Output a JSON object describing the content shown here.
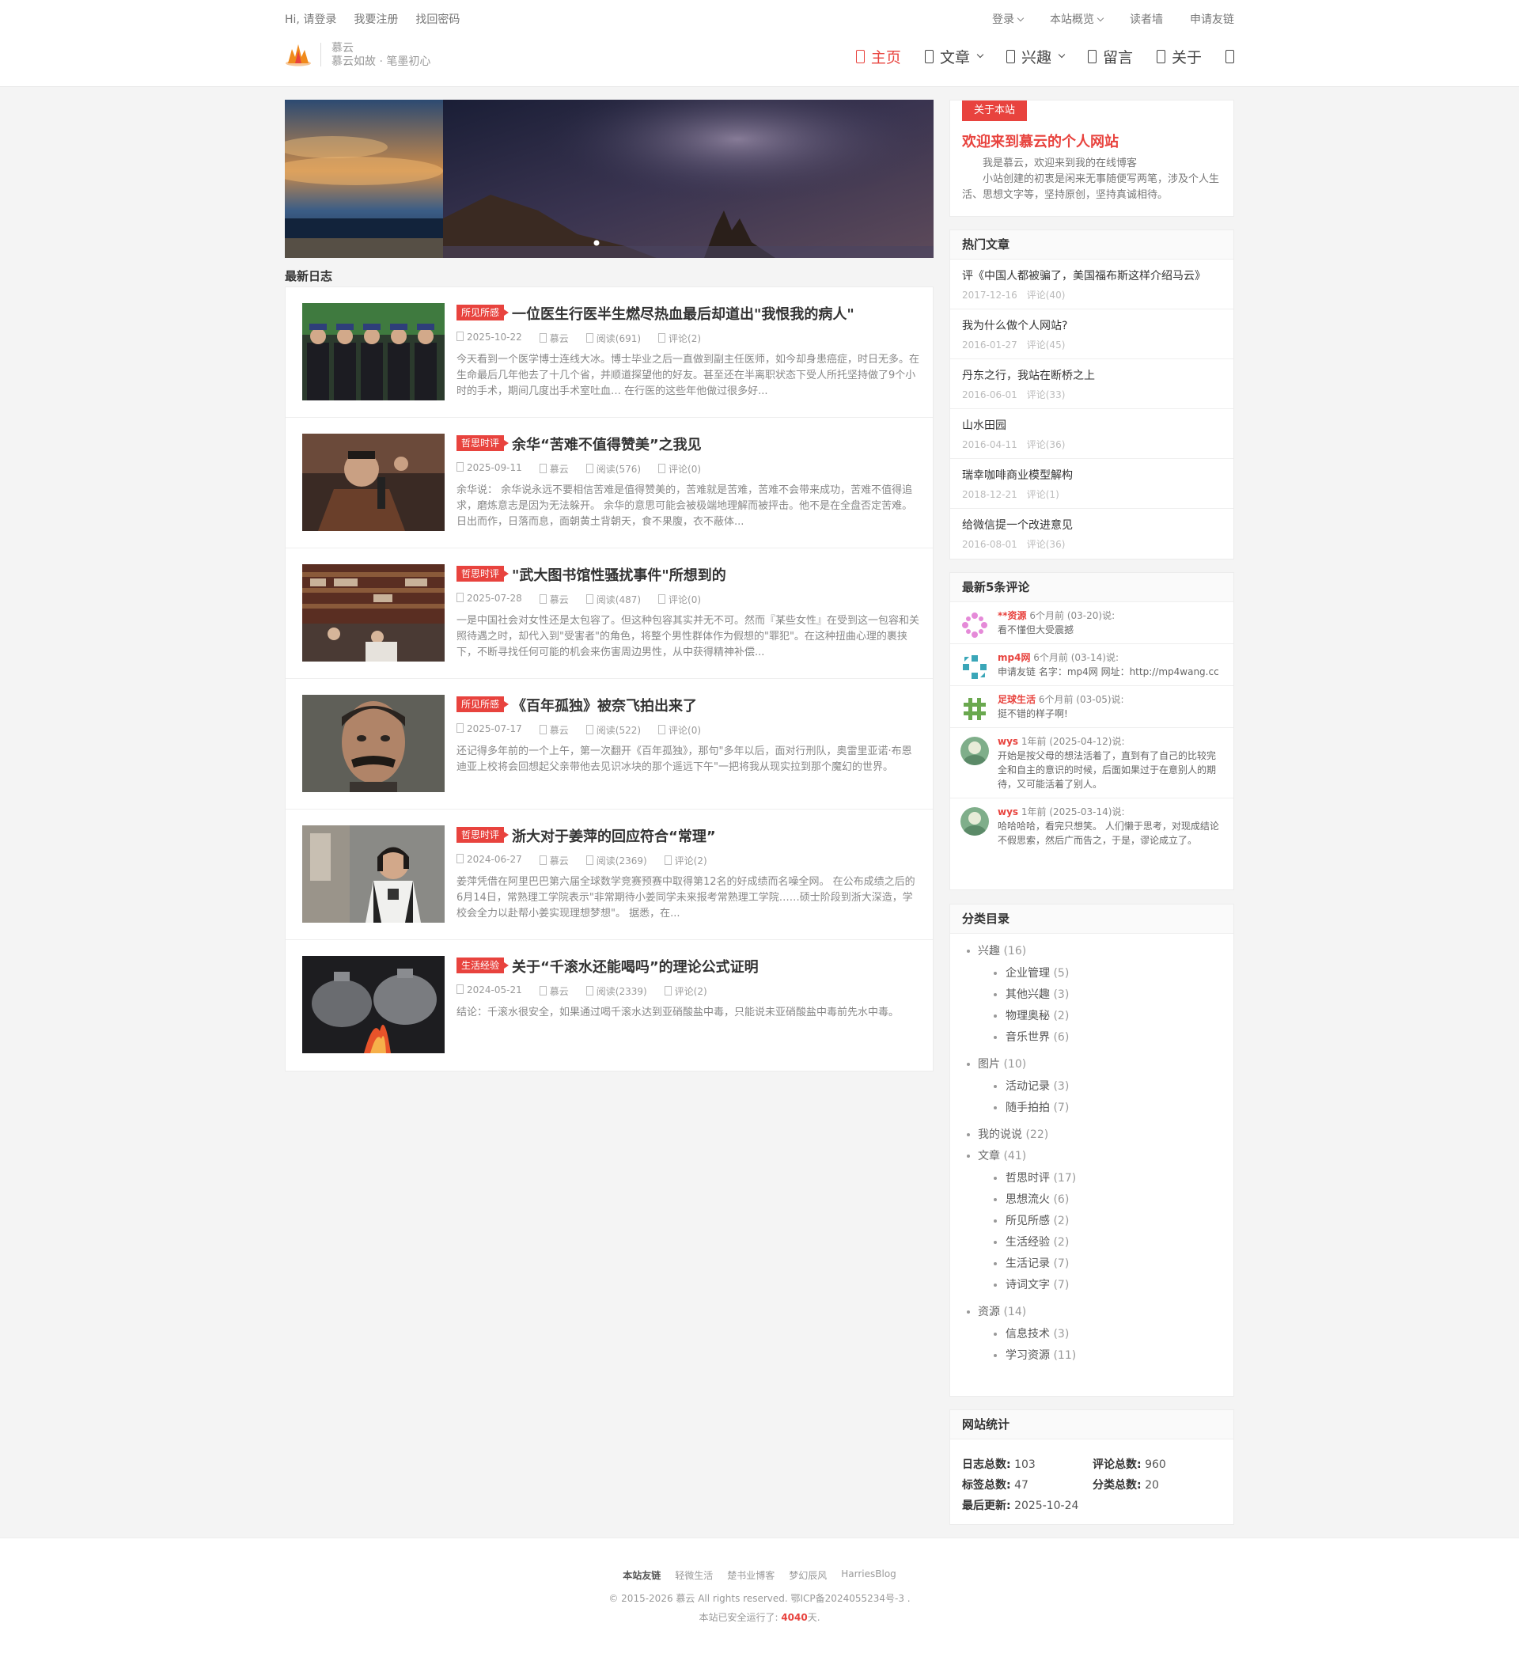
{
  "topbar": {
    "login_link": "Hi, 请登录",
    "register_link": "我要注册",
    "forgot_link": "找回密码",
    "right": [
      "登录",
      "本站概览",
      "读者墙",
      "申请友链"
    ]
  },
  "logo": {
    "name": "慕云",
    "slogan": "慕云如故 · 笔墨初心"
  },
  "nav": [
    {
      "label": "主页",
      "icon": "home-icon"
    },
    {
      "label": "文章",
      "icon": "book-icon"
    },
    {
      "label": "兴趣",
      "icon": "heart-icon"
    },
    {
      "label": "留言",
      "icon": "message-icon"
    },
    {
      "label": "关于",
      "icon": "user-icon"
    }
  ],
  "section_title": "最新日志",
  "posts": [
    {
      "tag": "所见所感",
      "title": "一位医生行医半生燃尽热血最后却道出\"我恨我的病人\"",
      "date": "2025-10-22",
      "author": "慕云",
      "views": "阅读(691)",
      "comments": "评论(2)",
      "excerpt": "今天看到一个医学博士连线大冰。博士毕业之后一直做到副主任医师，如今却身患癌症，时日无多。在生命最后几年他去了十几个省，并顺道探望他的好友。甚至还在半离职状态下受人所托坚持做了9个小时的手术，期间几度出手术室吐血… 在行医的这些年他做过很多好..."
    },
    {
      "tag": "哲思时评",
      "title": "余华“苦难不值得赞美”之我见",
      "date": "2025-09-11",
      "author": "慕云",
      "views": "阅读(576)",
      "comments": "评论(0)",
      "excerpt": "余华说： 余华说永远不要相信苦难是值得赞美的，苦难就是苦难，苦难不会带来成功，苦难不值得追求，磨炼意志是因为无法躲开。 余华的意思可能会被极端地理解而被抨击。他不是在全盘否定苦难。 日出而作，日落而息，面朝黄土背朝天，食不果腹，衣不蔽体..."
    },
    {
      "tag": "哲思时评",
      "title": "\"武大图书馆性骚扰事件\"所想到的",
      "date": "2025-07-28",
      "author": "慕云",
      "views": "阅读(487)",
      "comments": "评论(0)",
      "excerpt": "一是中国社会对女性还是太包容了。但这种包容其实并无不可。然而『某些女性』在受到这一包容和关照待遇之时，却代入到\"受害者\"的角色，将整个男性群体作为假想的\"罪犯\"。在这种扭曲心理的裹挟下，不断寻找任何可能的机会来伤害周边男性，从中获得精神补偿..."
    },
    {
      "tag": "所见所感",
      "title": "《百年孤独》被奈飞拍出来了",
      "date": "2025-07-17",
      "author": "慕云",
      "views": "阅读(522)",
      "comments": "评论(0)",
      "excerpt": "还记得多年前的一个上午，第一次翻开《百年孤独》，那句\"多年以后，面对行刑队，奥雷里亚诺·布恩迪亚上校将会回想起父亲带他去见识冰块的那个遥远下午\"一把将我从现实拉到那个魔幻的世界。"
    },
    {
      "tag": "哲思时评",
      "title": "浙大对于姜萍的回应符合“常理”",
      "date": "2024-06-27",
      "author": "慕云",
      "views": "阅读(2369)",
      "comments": "评论(2)",
      "excerpt": "姜萍凭借在阿里巴巴第六届全球数学竞赛预赛中取得第12名的好成绩而名噪全网。 在公布成绩之后的6月14日，常熟理工学院表示\"非常期待小姜同学未来报考常熟理工学院……硕士阶段到浙大深造，学校会全力以赴帮小姜实现理想梦想\"。 据悉，在..."
    },
    {
      "tag": "生活经验",
      "title": "关于“千滚水还能喝吗”的理论公式证明",
      "date": "2024-05-21",
      "author": "慕云",
      "views": "阅读(2339)",
      "comments": "评论(2)",
      "excerpt": "结论：千滚水很安全，如果通过喝千滚水达到亚硝酸盐中毒，只能说未亚硝酸盐中毒前先水中毒。"
    }
  ],
  "about": {
    "badge": "关于本站",
    "heading": "欢迎来到慕云的个人网站",
    "body": "我是慕云，欢迎来到我的在线博客",
    "body2": "小站创建的初衷是闲来无事随便写两笔，涉及个人生活、思想文字等，坚持原创，坚持真诚相待。"
  },
  "hot": {
    "title": "热门文章",
    "items": [
      {
        "title": "评《中国人都被骗了，美国福布斯这样介绍马云》",
        "date": "2017-12-16",
        "comments": "评论(40)"
      },
      {
        "title": "我为什么做个人网站?",
        "date": "2016-01-27",
        "comments": "评论(45)"
      },
      {
        "title": "丹东之行，我站在断桥之上",
        "date": "2016-06-01",
        "comments": "评论(33)"
      },
      {
        "title": "山水田园",
        "date": "2016-04-11",
        "comments": "评论(36)"
      },
      {
        "title": "瑞幸咖啡商业模型解构",
        "date": "2018-12-21",
        "comments": "评论(1)"
      },
      {
        "title": "给微信提一个改进意见",
        "date": "2016-08-01",
        "comments": "评论(36)"
      }
    ]
  },
  "comments": {
    "title": "最新5条评论",
    "items": [
      {
        "name": "**资源",
        "time": "6个月前 (03-20)说:",
        "text": "看不懂但大受震撼"
      },
      {
        "name": "mp4网",
        "time": "6个月前 (03-14)说:",
        "text": "申请友链 名字：mp4网 网址：http://mp4wang.cc"
      },
      {
        "name": "足球生活",
        "time": "6个月前 (03-05)说:",
        "text": "挺不错的样子啊!"
      },
      {
        "name": "wys",
        "time": "1年前 (2025-04-12)说:",
        "text": "开始是按父母的想法活着了，直到有了自己的比较完全和自主的意识的时候，后面如果过于在意别人的期待，又可能活着了别人。"
      },
      {
        "name": "wys",
        "time": "1年前 (2025-03-14)说:",
        "text": "哈哈哈哈，看完只想笑。 人们懒于思考，对现成结论不假思索，然后广而告之，于是，谬论成立了。"
      }
    ]
  },
  "categories": {
    "title": "分类目录",
    "groups": [
      {
        "name": "兴趣",
        "count": "(16)",
        "children": [
          {
            "name": "企业管理",
            "count": "(5)"
          },
          {
            "name": "其他兴趣",
            "count": "(3)"
          },
          {
            "name": "物理奥秘",
            "count": "(2)"
          },
          {
            "name": "音乐世界",
            "count": "(6)"
          }
        ]
      },
      {
        "name": "图片",
        "count": "(10)",
        "children": [
          {
            "name": "活动记录",
            "count": "(3)"
          },
          {
            "name": "随手拍拍",
            "count": "(7)"
          }
        ]
      },
      {
        "name": "我的说说",
        "count": "(22)",
        "children": []
      },
      {
        "name": "文章",
        "count": "(41)",
        "children": [
          {
            "name": "哲思时评",
            "count": "(17)"
          },
          {
            "name": "思想流火",
            "count": "(6)"
          },
          {
            "name": "所见所感",
            "count": "(2)"
          },
          {
            "name": "生活经验",
            "count": "(2)"
          },
          {
            "name": "生活记录",
            "count": "(7)"
          },
          {
            "name": "诗词文字",
            "count": "(7)"
          }
        ]
      },
      {
        "name": "资源",
        "count": "(14)",
        "children": [
          {
            "name": "信息技术",
            "count": "(3)"
          },
          {
            "name": "学习资源",
            "count": "(11)"
          }
        ]
      }
    ]
  },
  "stats": {
    "title": "网站统计",
    "posts_label": "日志总数:",
    "posts": "103",
    "comments_label": "评论总数:",
    "comments": "960",
    "tags_label": "标签总数:",
    "tags": "47",
    "cats_label": "分类总数:",
    "cats": "20",
    "updated_label": "最后更新:",
    "updated": "2025-10-24"
  },
  "footer": {
    "links_label": "本站友链",
    "links": [
      "轻微生活",
      "楚书业博客",
      "梦幻辰风",
      "HarriesBlog"
    ],
    "copyright": "© 2015-2026   慕云   All rights reserved. 鄂ICP备2024055234号-3 .",
    "run_prefix": "本站已安全运行了:",
    "run_days": "4040",
    "run_suffix": "天."
  },
  "colors": {
    "accent": "#e8433e",
    "text": "#333333",
    "muted": "#999999",
    "background": "#f4f4f4"
  }
}
